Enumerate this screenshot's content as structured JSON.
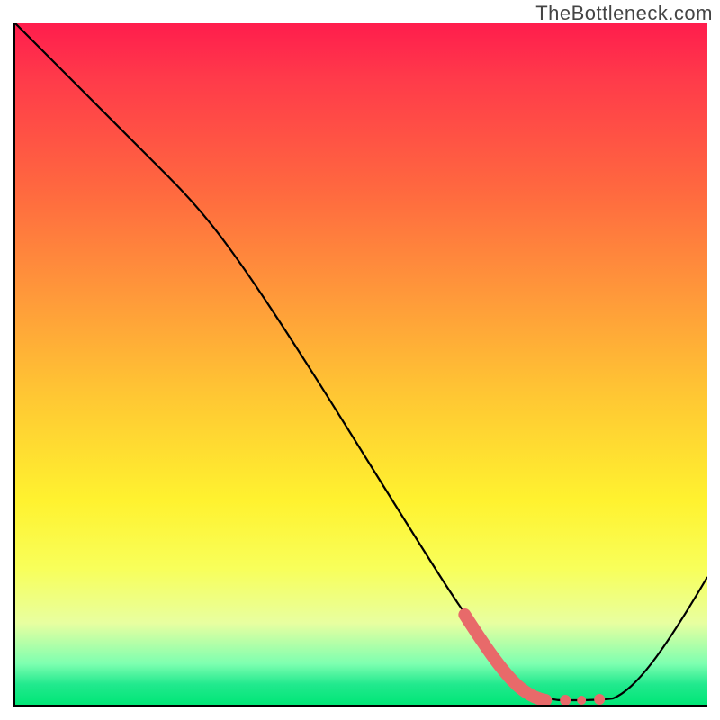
{
  "watermark": "TheBottleneck.com",
  "chart_data": {
    "type": "line",
    "title": "",
    "xlabel": "",
    "ylabel": "",
    "xlim": [
      0,
      100
    ],
    "ylim": [
      0,
      100
    ],
    "series": [
      {
        "name": "bottleneck-curve",
        "x": [
          0,
          10,
          22,
          35,
          50,
          62,
          70,
          74,
          78,
          82,
          86,
          100
        ],
        "values": [
          100,
          92,
          78,
          60,
          40,
          24,
          12,
          4,
          1,
          1,
          2,
          20
        ]
      }
    ],
    "highlight": {
      "name": "optimal-range",
      "color": "#e86a6a",
      "x": [
        66,
        70,
        73,
        75,
        78,
        80,
        82
      ],
      "values": [
        17,
        11,
        6,
        3,
        1.5,
        1.2,
        1.2
      ]
    },
    "gradient_stops": [
      {
        "pos": 0,
        "color": "#ff1d4d"
      },
      {
        "pos": 25,
        "color": "#ff6a3f"
      },
      {
        "pos": 55,
        "color": "#ffc833"
      },
      {
        "pos": 80,
        "color": "#f8ff5a"
      },
      {
        "pos": 97,
        "color": "#22e98e"
      },
      {
        "pos": 100,
        "color": "#00e676"
      }
    ]
  }
}
